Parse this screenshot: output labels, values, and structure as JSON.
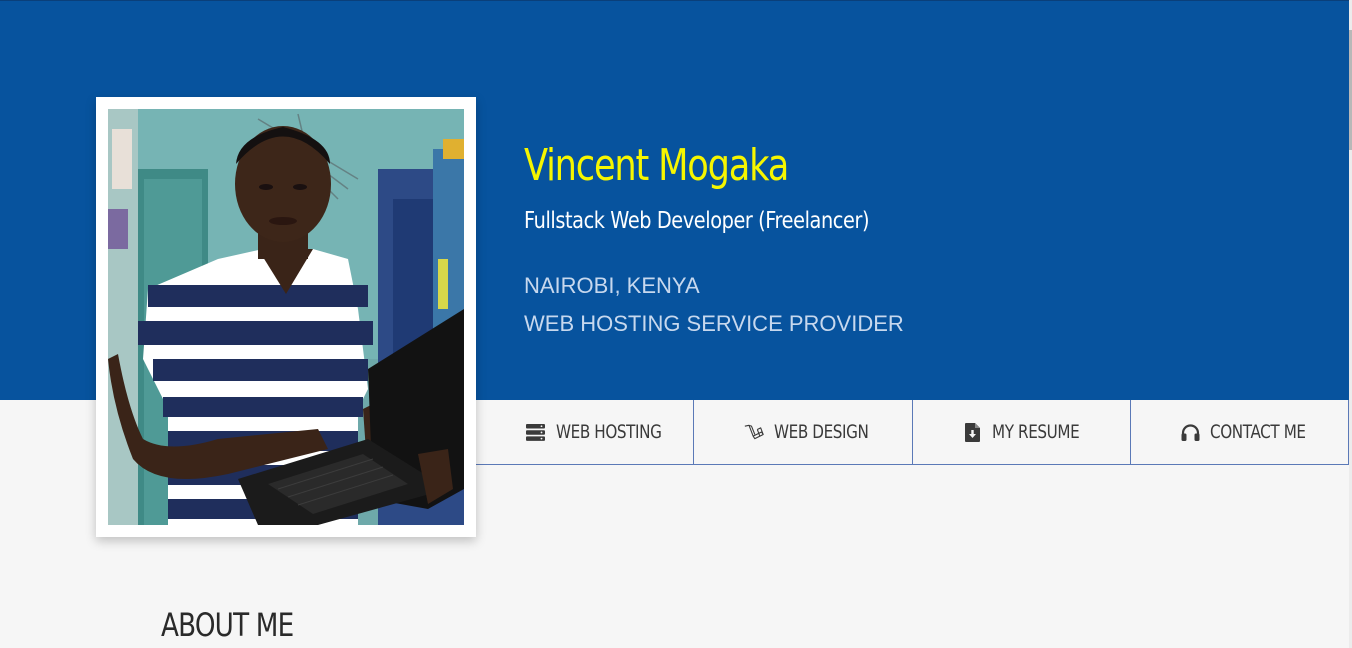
{
  "profile": {
    "name": "Vincent Mogaka",
    "role": "Fullstack Web Developer (Freelancer)",
    "location": "NAIROBI, KENYA",
    "service": "WEB HOSTING SERVICE PROVIDER"
  },
  "nav": {
    "items": [
      {
        "label": "WEB HOSTING",
        "icon": "server-icon"
      },
      {
        "label": "WEB DESIGN",
        "icon": "laravel-icon"
      },
      {
        "label": "MY RESUME",
        "icon": "file-download-icon"
      },
      {
        "label": "CONTACT ME",
        "icon": "headphones-icon"
      }
    ]
  },
  "sections": {
    "about_title": "ABOUT ME"
  },
  "colors": {
    "hero_background": "#07539e",
    "name_color": "#f6f600",
    "page_background": "#f6f6f6",
    "nav_border": "#5b79b7"
  }
}
